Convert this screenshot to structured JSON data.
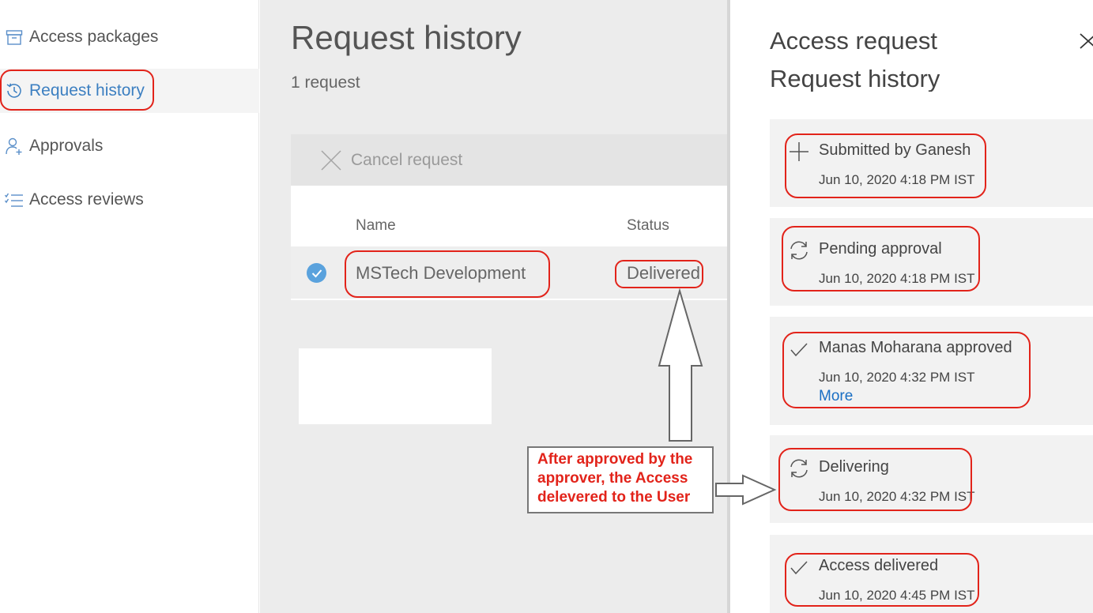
{
  "sidebar": {
    "items": [
      {
        "label": "Access packages",
        "icon": "package-icon",
        "selected": false
      },
      {
        "label": "Request history",
        "icon": "history-icon",
        "selected": true
      },
      {
        "label": "Approvals",
        "icon": "person-add-icon",
        "selected": false
      },
      {
        "label": "Access reviews",
        "icon": "checklist-icon",
        "selected": false
      }
    ]
  },
  "main": {
    "title": "Request history",
    "count": "1 request",
    "toolbar": {
      "cancel_label": "Cancel request",
      "cancel_icon": "close-icon"
    },
    "table": {
      "columns": [
        "Name",
        "Status"
      ],
      "rows": [
        {
          "selected": true,
          "name": "MSTech Development",
          "status": "Delivered"
        }
      ]
    }
  },
  "panel": {
    "title": "Access request",
    "section_title": "Request history",
    "events": [
      {
        "icon": "plus-icon",
        "title": "Submitted by Ganesh",
        "time": "Jun 10, 2020 4:18 PM IST"
      },
      {
        "icon": "sync-icon",
        "title": "Pending approval",
        "time": "Jun 10, 2020 4:18 PM IST"
      },
      {
        "icon": "checkmark-icon",
        "title": "Manas Moharana approved",
        "time": "Jun 10, 2020 4:32 PM IST",
        "more": "More"
      },
      {
        "icon": "sync-icon",
        "title": "Delivering",
        "time": "Jun 10, 2020 4:32 PM IST"
      },
      {
        "icon": "checkmark-icon",
        "title": "Access delivered",
        "time": "Jun 10, 2020 4:45 PM IST"
      }
    ]
  },
  "annotation": {
    "lines": [
      "After approved by the",
      "approver, the Access",
      "delevered to the User"
    ],
    "text_color": "#e2231a",
    "highlight_color": "#e2231a"
  },
  "colors": {
    "accent": "#3c7fc1",
    "link": "#1a6fc4",
    "checkbox": "#5aa2dd"
  }
}
